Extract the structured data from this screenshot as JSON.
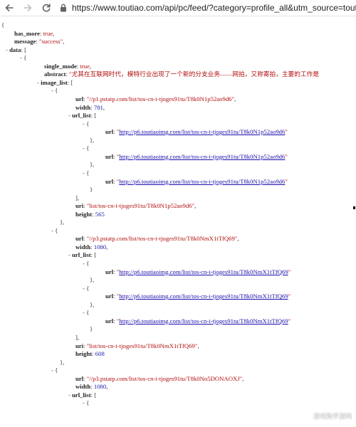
{
  "browser": {
    "url_display": "https://www.toutiao.com/api/pc/feed/?category=profile_all&utm_source=toutiao"
  },
  "icons": {
    "back": "arrow-left",
    "forward": "arrow-right",
    "reload": "reload",
    "lock": "lock"
  },
  "json": {
    "lines": [
      {
        "indent": 2,
        "toggle": "",
        "parts": [
          {
            "t": "{",
            "c": "punc"
          }
        ]
      },
      {
        "indent": 20,
        "toggle": "",
        "parts": [
          {
            "t": "has_more",
            "c": "key"
          },
          {
            "t": ": ",
            "c": "punc"
          },
          {
            "t": "true",
            "c": "bool"
          },
          {
            "t": ",",
            "c": "punc"
          }
        ]
      },
      {
        "indent": 20,
        "toggle": "",
        "parts": [
          {
            "t": "message",
            "c": "key"
          },
          {
            "t": ": ",
            "c": "punc"
          },
          {
            "t": "\"success\"",
            "c": "str"
          },
          {
            "t": ",",
            "c": "punc"
          }
        ]
      },
      {
        "indent": 8,
        "toggle": "-",
        "parts": [
          {
            "t": "data",
            "c": "key"
          },
          {
            "t": ": [",
            "c": "punc"
          }
        ]
      },
      {
        "indent": 28,
        "toggle": "-",
        "parts": [
          {
            "t": "{",
            "c": "punc"
          }
        ]
      },
      {
        "indent": 62,
        "toggle": "",
        "parts": [
          {
            "t": "single_mode",
            "c": "key"
          },
          {
            "t": ": ",
            "c": "punc"
          },
          {
            "t": "true",
            "c": "bool"
          },
          {
            "t": ",",
            "c": "punc"
          }
        ]
      },
      {
        "indent": 62,
        "toggle": "",
        "parts": [
          {
            "t": "abstract",
            "c": "key"
          },
          {
            "t": ": ",
            "c": "punc"
          },
          {
            "t": "\"尤其在互联网时代，模特行业出现了一个新的分支业务——网拍，又称寄拍，主要的工作是",
            "c": "str"
          }
        ]
      },
      {
        "indent": 52,
        "toggle": "-",
        "parts": [
          {
            "t": "image_list",
            "c": "key"
          },
          {
            "t": ": [",
            "c": "punc"
          }
        ]
      },
      {
        "indent": 72,
        "toggle": "-",
        "parts": [
          {
            "t": "{",
            "c": "punc"
          }
        ]
      },
      {
        "indent": 106,
        "toggle": "",
        "parts": [
          {
            "t": "url",
            "c": "key"
          },
          {
            "t": ": ",
            "c": "punc"
          },
          {
            "t": "\"//p1.pstatp.com/list/tos-cn-i-tjoges91tu/T8k0N1p52ao9d6\"",
            "c": "str"
          },
          {
            "t": ",",
            "c": "punc"
          }
        ]
      },
      {
        "indent": 106,
        "toggle": "",
        "parts": [
          {
            "t": "width",
            "c": "key"
          },
          {
            "t": ": ",
            "c": "punc"
          },
          {
            "t": "781",
            "c": "num"
          },
          {
            "t": ",",
            "c": "punc"
          }
        ]
      },
      {
        "indent": 96,
        "toggle": "-",
        "parts": [
          {
            "t": "url_list",
            "c": "key"
          },
          {
            "t": ": [",
            "c": "punc"
          }
        ]
      },
      {
        "indent": 116,
        "toggle": "-",
        "parts": [
          {
            "t": "{",
            "c": "punc"
          }
        ]
      },
      {
        "indent": 148,
        "toggle": "",
        "parts": [
          {
            "t": "url",
            "c": "key"
          },
          {
            "t": ": ",
            "c": "punc"
          },
          {
            "t": "\"",
            "c": "link-wrap"
          },
          {
            "t": "http://p6.toutiaoimg.com/list/tos-cn-i-tjoges91tu/T8k0N1p52ao9d6",
            "c": "link"
          },
          {
            "t": "\"",
            "c": "link-wrap"
          }
        ]
      },
      {
        "indent": 126,
        "toggle": "",
        "parts": [
          {
            "t": "},",
            "c": "punc"
          }
        ]
      },
      {
        "indent": 116,
        "toggle": "-",
        "parts": [
          {
            "t": "{",
            "c": "punc"
          }
        ]
      },
      {
        "indent": 148,
        "toggle": "",
        "parts": [
          {
            "t": "url",
            "c": "key"
          },
          {
            "t": ": ",
            "c": "punc"
          },
          {
            "t": "\"",
            "c": "link-wrap"
          },
          {
            "t": "http://p6.toutiaoimg.com/list/tos-cn-i-tjoges91tu/T8k0N1p52ao9d6",
            "c": "link"
          },
          {
            "t": "\"",
            "c": "link-wrap"
          }
        ]
      },
      {
        "indent": 126,
        "toggle": "",
        "parts": [
          {
            "t": "},",
            "c": "punc"
          }
        ]
      },
      {
        "indent": 116,
        "toggle": "-",
        "parts": [
          {
            "t": "{",
            "c": "punc"
          }
        ]
      },
      {
        "indent": 148,
        "toggle": "",
        "parts": [
          {
            "t": "url",
            "c": "key"
          },
          {
            "t": ": ",
            "c": "punc"
          },
          {
            "t": "\"",
            "c": "link-wrap"
          },
          {
            "t": "http://p6.toutiaoimg.com/list/tos-cn-i-tjoges91tu/T8k0N1p52ao9d6",
            "c": "link"
          },
          {
            "t": "\"",
            "c": "link-wrap"
          }
        ]
      },
      {
        "indent": 126,
        "toggle": "",
        "parts": [
          {
            "t": "}",
            "c": "punc"
          }
        ]
      },
      {
        "indent": 106,
        "toggle": "",
        "parts": [
          {
            "t": "],",
            "c": "punc"
          }
        ]
      },
      {
        "indent": 106,
        "toggle": "",
        "parts": [
          {
            "t": "uri",
            "c": "key"
          },
          {
            "t": ": ",
            "c": "punc"
          },
          {
            "t": "\"list/tos-cn-i-tjoges91tu/T8k0N1p52ao9d6\"",
            "c": "str"
          },
          {
            "t": ",",
            "c": "punc"
          }
        ]
      },
      {
        "indent": 106,
        "toggle": "",
        "parts": [
          {
            "t": "height",
            "c": "key"
          },
          {
            "t": ": ",
            "c": "punc"
          },
          {
            "t": "565",
            "c": "num"
          }
        ]
      },
      {
        "indent": 84,
        "toggle": "",
        "parts": [
          {
            "t": "},",
            "c": "punc"
          }
        ]
      },
      {
        "indent": 72,
        "toggle": "-",
        "parts": [
          {
            "t": "{",
            "c": "punc"
          }
        ]
      },
      {
        "indent": 106,
        "toggle": "",
        "parts": [
          {
            "t": "url",
            "c": "key"
          },
          {
            "t": ": ",
            "c": "punc"
          },
          {
            "t": "\"//p3.pstatp.com/list/tos-cn-i-tjoges91tu/T8k0NmX1tTfQ69\"",
            "c": "str"
          },
          {
            "t": ",",
            "c": "punc"
          }
        ]
      },
      {
        "indent": 106,
        "toggle": "",
        "parts": [
          {
            "t": "width",
            "c": "key"
          },
          {
            "t": ": ",
            "c": "punc"
          },
          {
            "t": "1080",
            "c": "num"
          },
          {
            "t": ",",
            "c": "punc"
          }
        ]
      },
      {
        "indent": 96,
        "toggle": "-",
        "parts": [
          {
            "t": "url_list",
            "c": "key"
          },
          {
            "t": ": [",
            "c": "punc"
          }
        ]
      },
      {
        "indent": 116,
        "toggle": "-",
        "parts": [
          {
            "t": "{",
            "c": "punc"
          }
        ]
      },
      {
        "indent": 148,
        "toggle": "",
        "parts": [
          {
            "t": "url",
            "c": "key"
          },
          {
            "t": ": ",
            "c": "punc"
          },
          {
            "t": "\"",
            "c": "link-wrap"
          },
          {
            "t": "http://p6.toutiaoimg.com/list/tos-cn-i-tjoges91tu/T8k0NmX1tTfQ69",
            "c": "link"
          },
          {
            "t": "\"",
            "c": "link-wrap"
          }
        ]
      },
      {
        "indent": 126,
        "toggle": "",
        "parts": [
          {
            "t": "},",
            "c": "punc"
          }
        ]
      },
      {
        "indent": 116,
        "toggle": "-",
        "parts": [
          {
            "t": "{",
            "c": "punc"
          }
        ]
      },
      {
        "indent": 148,
        "toggle": "",
        "parts": [
          {
            "t": "url",
            "c": "key"
          },
          {
            "t": ": ",
            "c": "punc"
          },
          {
            "t": "\"",
            "c": "link-wrap"
          },
          {
            "t": "http://p6.toutiaoimg.com/list/tos-cn-i-tjoges91tu/T8k0NmX1tTfQ69",
            "c": "link"
          },
          {
            "t": "\"",
            "c": "link-wrap"
          }
        ]
      },
      {
        "indent": 126,
        "toggle": "",
        "parts": [
          {
            "t": "},",
            "c": "punc"
          }
        ]
      },
      {
        "indent": 116,
        "toggle": "-",
        "parts": [
          {
            "t": "{",
            "c": "punc"
          }
        ]
      },
      {
        "indent": 148,
        "toggle": "",
        "parts": [
          {
            "t": "url",
            "c": "key"
          },
          {
            "t": ": ",
            "c": "punc"
          },
          {
            "t": "\"",
            "c": "link-wrap"
          },
          {
            "t": "http://p6.toutiaoimg.com/list/tos-cn-i-tjoges91tu/T8k0NmX1tTfQ69",
            "c": "link"
          },
          {
            "t": "\"",
            "c": "link-wrap"
          }
        ]
      },
      {
        "indent": 126,
        "toggle": "",
        "parts": [
          {
            "t": "}",
            "c": "punc"
          }
        ]
      },
      {
        "indent": 106,
        "toggle": "",
        "parts": [
          {
            "t": "],",
            "c": "punc"
          }
        ]
      },
      {
        "indent": 106,
        "toggle": "",
        "parts": [
          {
            "t": "uri",
            "c": "key"
          },
          {
            "t": ": ",
            "c": "punc"
          },
          {
            "t": "\"list/tos-cn-i-tjoges91tu/T8k0NmX1tTfQ69\"",
            "c": "str"
          },
          {
            "t": ",",
            "c": "punc"
          }
        ]
      },
      {
        "indent": 106,
        "toggle": "",
        "parts": [
          {
            "t": "height",
            "c": "key"
          },
          {
            "t": ": ",
            "c": "punc"
          },
          {
            "t": "608",
            "c": "num"
          }
        ]
      },
      {
        "indent": 84,
        "toggle": "",
        "parts": [
          {
            "t": "},",
            "c": "punc"
          }
        ]
      },
      {
        "indent": 72,
        "toggle": "-",
        "parts": [
          {
            "t": "{",
            "c": "punc"
          }
        ]
      },
      {
        "indent": 106,
        "toggle": "",
        "parts": [
          {
            "t": "url",
            "c": "key"
          },
          {
            "t": ": ",
            "c": "punc"
          },
          {
            "t": "\"//p3.pstatp.com/list/tos-cn-i-tjoges91tu/T8k0Nn5DONAOXJ\"",
            "c": "str"
          },
          {
            "t": ",",
            "c": "punc"
          }
        ]
      },
      {
        "indent": 106,
        "toggle": "",
        "parts": [
          {
            "t": "width",
            "c": "key"
          },
          {
            "t": ": ",
            "c": "punc"
          },
          {
            "t": "1080",
            "c": "num"
          },
          {
            "t": ",",
            "c": "punc"
          }
        ]
      },
      {
        "indent": 96,
        "toggle": "-",
        "parts": [
          {
            "t": "url_list",
            "c": "key"
          },
          {
            "t": ": [",
            "c": "punc"
          }
        ]
      },
      {
        "indent": 116,
        "toggle": "-",
        "parts": [
          {
            "t": "{",
            "c": "punc"
          }
        ]
      }
    ]
  },
  "watermark": {
    "text": "游戏狗手游网"
  }
}
